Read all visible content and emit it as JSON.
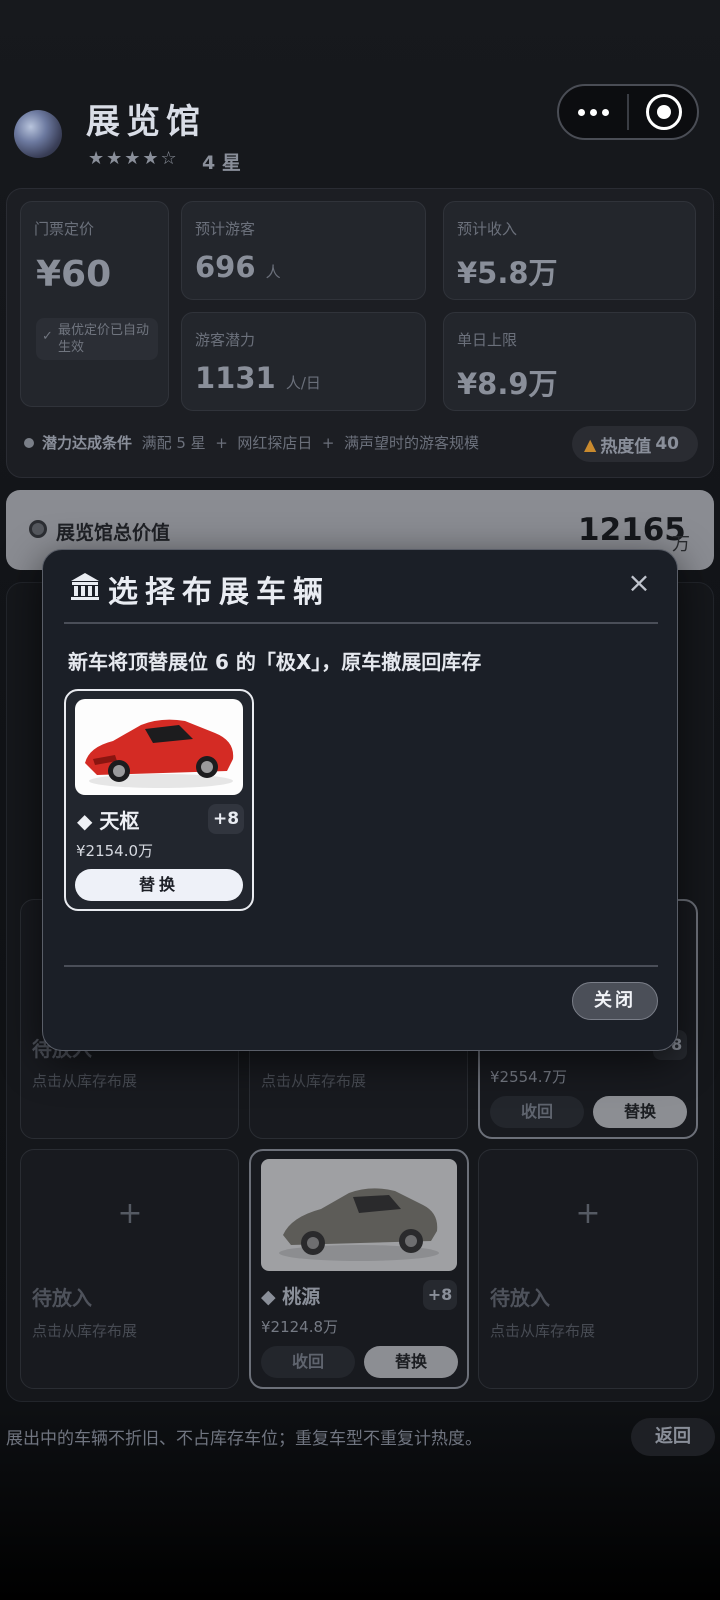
{
  "header": {
    "title": "展览馆",
    "stars": "★★★★☆",
    "stars_text": "4 星",
    "capsule": {
      "more_icon": "more-dots-icon",
      "target_icon": "target-icon"
    }
  },
  "stats": {
    "ticket": {
      "label": "门票定价",
      "value": "¥60",
      "badge": "最优定价已自动生效"
    },
    "visitors": {
      "label": "预计游客",
      "value": "696",
      "unit": "人"
    },
    "income": {
      "label": "预计收入",
      "value": "¥5.8万"
    },
    "potential": {
      "label": "游客潜力",
      "value": "1131",
      "unit": "人/日"
    },
    "daily_cap": {
      "label": "单日上限",
      "value": "¥8.9万"
    },
    "condition": {
      "title": "潜力达成条件",
      "items": [
        "满配 5 星",
        "+",
        "网红探店日",
        "+",
        "满声望时的游客规模"
      ]
    },
    "heat": {
      "icon": "flame-icon",
      "label": "热度值",
      "value": "40"
    }
  },
  "total": {
    "label": "展览馆总价值",
    "value": "12165",
    "unit": "万"
  },
  "slots": {
    "empty_title": "待放入",
    "empty_sub": "点击从库存布展",
    "cars": [
      {
        "name": "◆ 桃源",
        "plus": "+8",
        "price": "¥2124.8万",
        "recall": "收回",
        "replace": "替换"
      },
      {
        "name": "◆",
        "plus": "+8",
        "price": "¥2554.7万",
        "recall": "收回",
        "replace": "替换"
      }
    ]
  },
  "footer": {
    "note": "展出中的车辆不折旧、不占库存车位；重复车型不重复计热度。",
    "back": "返回"
  },
  "modal": {
    "title": "选择布展车辆",
    "desc": "新车将顶替展位 6 的「极X」，原车撤展回库存",
    "option": {
      "name": "◆ 天枢",
      "plus": "+8",
      "price": "¥2154.0万",
      "button": "替换"
    },
    "close": "关闭",
    "close_icon": "close-icon"
  },
  "colors": {
    "accent": "#e9ebf0",
    "background": "#121418",
    "modal": "#1b1f27"
  }
}
